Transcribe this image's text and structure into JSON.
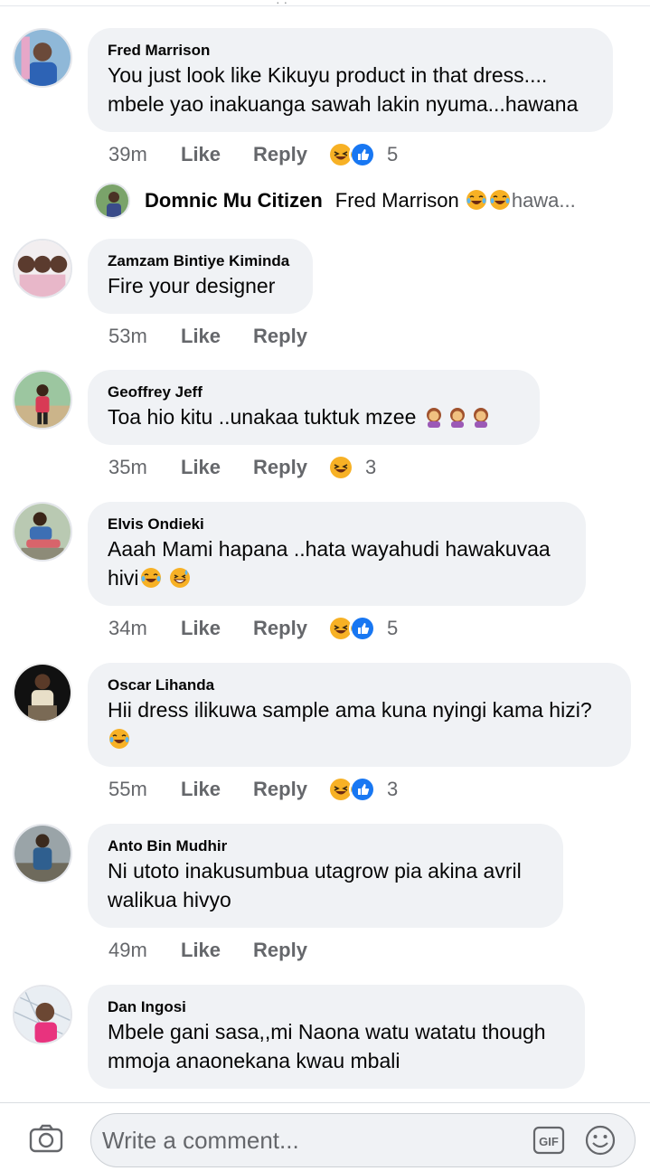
{
  "comments": [
    {
      "author": "Fred Marrison",
      "lines": [
        "You just look like Kikuyu product in that dress....",
        "mbele yao inakuanga sawah lakin nyuma...hawana"
      ],
      "time": "39m",
      "like": "Like",
      "reply": "Reply",
      "reactions": [
        "haha",
        "like"
      ],
      "count": "5"
    },
    {
      "author": "Zamzam Bintiye Kiminda",
      "lines": [
        "Fire your designer"
      ],
      "time": "53m",
      "like": "Like",
      "reply": "Reply",
      "reactions": [],
      "count": ""
    },
    {
      "author": "Geoffrey Jeff",
      "lines": [
        "Toa hio kitu ..unakaa tuktuk mzee"
      ],
      "time": "35m",
      "like": "Like",
      "reply": "Reply",
      "reactions": [
        "haha"
      ],
      "count": "3"
    },
    {
      "author": "Elvis Ondieki",
      "lines": [
        "Aaah Mami hapana ..hata wayahudi hawakuvaa",
        "hivi"
      ],
      "time": "34m",
      "like": "Like",
      "reply": "Reply",
      "reactions": [
        "haha",
        "like"
      ],
      "count": "5"
    },
    {
      "author": "Oscar Lihanda",
      "lines": [
        "Hii dress ilikuwa sample ama kuna nyingi kama hizi?"
      ],
      "time": "55m",
      "like": "Like",
      "reply": "Reply",
      "reactions": [
        "haha",
        "like"
      ],
      "count": "3"
    },
    {
      "author": "Anto Bin Mudhir",
      "lines": [
        "Ni utoto inakusumbua utagrow pia akina avril",
        "walikua hivyo"
      ],
      "time": "49m",
      "like": "Like",
      "reply": "Reply",
      "reactions": [],
      "count": ""
    },
    {
      "author": "Dan Ingosi",
      "lines": [
        "Mbele gani sasa,,mi Naona watu watatu though",
        "mmoja anaonekana kwau mbali"
      ],
      "time": "",
      "like": "",
      "reply": "",
      "reactions": [],
      "count": ""
    }
  ],
  "reply_preview": {
    "author": "Domnic Mu Citizen",
    "text": "Fred Marrison",
    "trail": "hawa..."
  },
  "footer": {
    "placeholder": "Write a comment...",
    "gif_label": "GIF"
  },
  "colors": {
    "bubble": "#f0f2f5",
    "meta": "#65676b",
    "like_blue": "#1877f2",
    "haha_yellow": "#f7b125"
  }
}
